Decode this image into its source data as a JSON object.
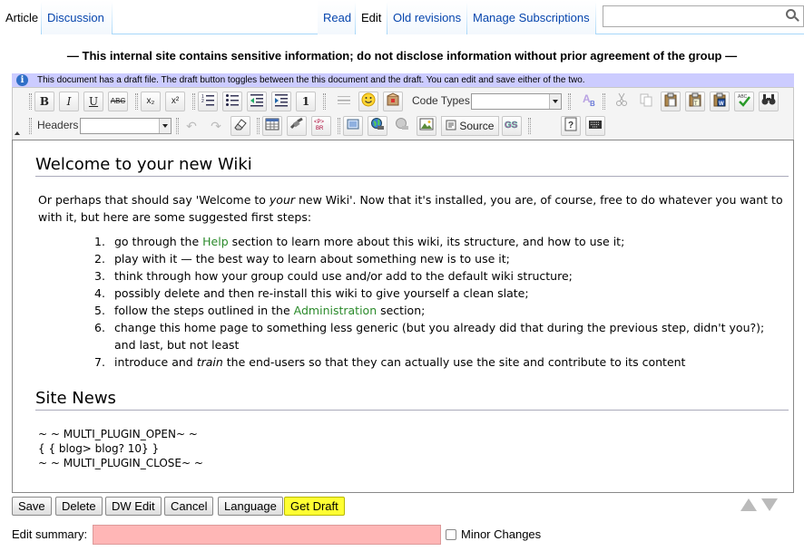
{
  "tabs": {
    "article": "Article",
    "discussion": "Discussion",
    "read": "Read",
    "edit": "Edit",
    "old_revisions": "Old revisions",
    "manage_subscriptions": "Manage Subscriptions"
  },
  "search": {
    "value": "",
    "icon": "search-icon"
  },
  "warning": "— This internal site contains sensitive information; do not disclose information without prior agreement of the group —",
  "draft_notice": "This document has a draft file. The draft button toggles between the this document and the draft. You can edit and save either of the two.",
  "toolbar": {
    "row1": {
      "bold": "B",
      "italic": "I",
      "underline": "U",
      "strike": "ABC",
      "subscript": "x₂",
      "superscript": "x²",
      "code_types_label": "Code Types",
      "code_types_value": ""
    },
    "row2": {
      "headers_label": "Headers",
      "headers_value": "",
      "source_label": "Source"
    }
  },
  "editor": {
    "heading": "Welcome to your new Wiki",
    "intro_line1_a": "Or perhaps that should say 'Welcome to ",
    "intro_line1_em": "your",
    "intro_line1_b": " new Wiki'. Now that it's installed, you are, of course, free to do whatever you want to",
    "intro_line2": "with it, but here are some suggested first steps:",
    "steps": [
      {
        "num": "1.",
        "pre": "go through the ",
        "link": "Help",
        "post": " section to learn more about this wiki, its structure, and how to use it;"
      },
      {
        "num": "2.",
        "text": "play with it — the best way to learn about something new is to use it;"
      },
      {
        "num": "3.",
        "text": "think through how your group could use and/or add to the default wiki structure;"
      },
      {
        "num": "4.",
        "text": "possibly delete and then re-install this wiki to give yourself a clean slate;"
      },
      {
        "num": "5.",
        "pre": "follow the steps outlined in the ",
        "link": "Administration",
        "post": " section;"
      },
      {
        "num": "6.",
        "line1": "change this home page to something less generic (but you already did that during the previous step, didn't you?);",
        "line2": "and last, but not least"
      },
      {
        "num": "7.",
        "pre": "introduce and ",
        "em": "train",
        "post": " the end-users so that they can actually use the site and contribute to its content"
      }
    ],
    "news_heading": "Site News",
    "plugin_lines": [
      "~ ~ MULTI_PLUGIN_OPEN~ ~",
      "{ { blog> blog? 10} }",
      "~ ~ MULTI_PLUGIN_CLOSE~ ~"
    ]
  },
  "buttons": {
    "save": "Save",
    "delete": "Delete",
    "dw_edit": "DW Edit",
    "cancel": "Cancel",
    "language": "Language",
    "get_draft": "Get Draft"
  },
  "edit_summary": {
    "label": "Edit summary:",
    "value": ""
  },
  "minor_changes": {
    "label": "Minor Changes",
    "checked": false
  },
  "colors": {
    "get_draft_bg": "#ffff33",
    "summary_bg": "#ffb6b6",
    "draft_bar": "#ccccff",
    "link_green": "#2b8a2b",
    "tab_link": "#0645ad"
  }
}
